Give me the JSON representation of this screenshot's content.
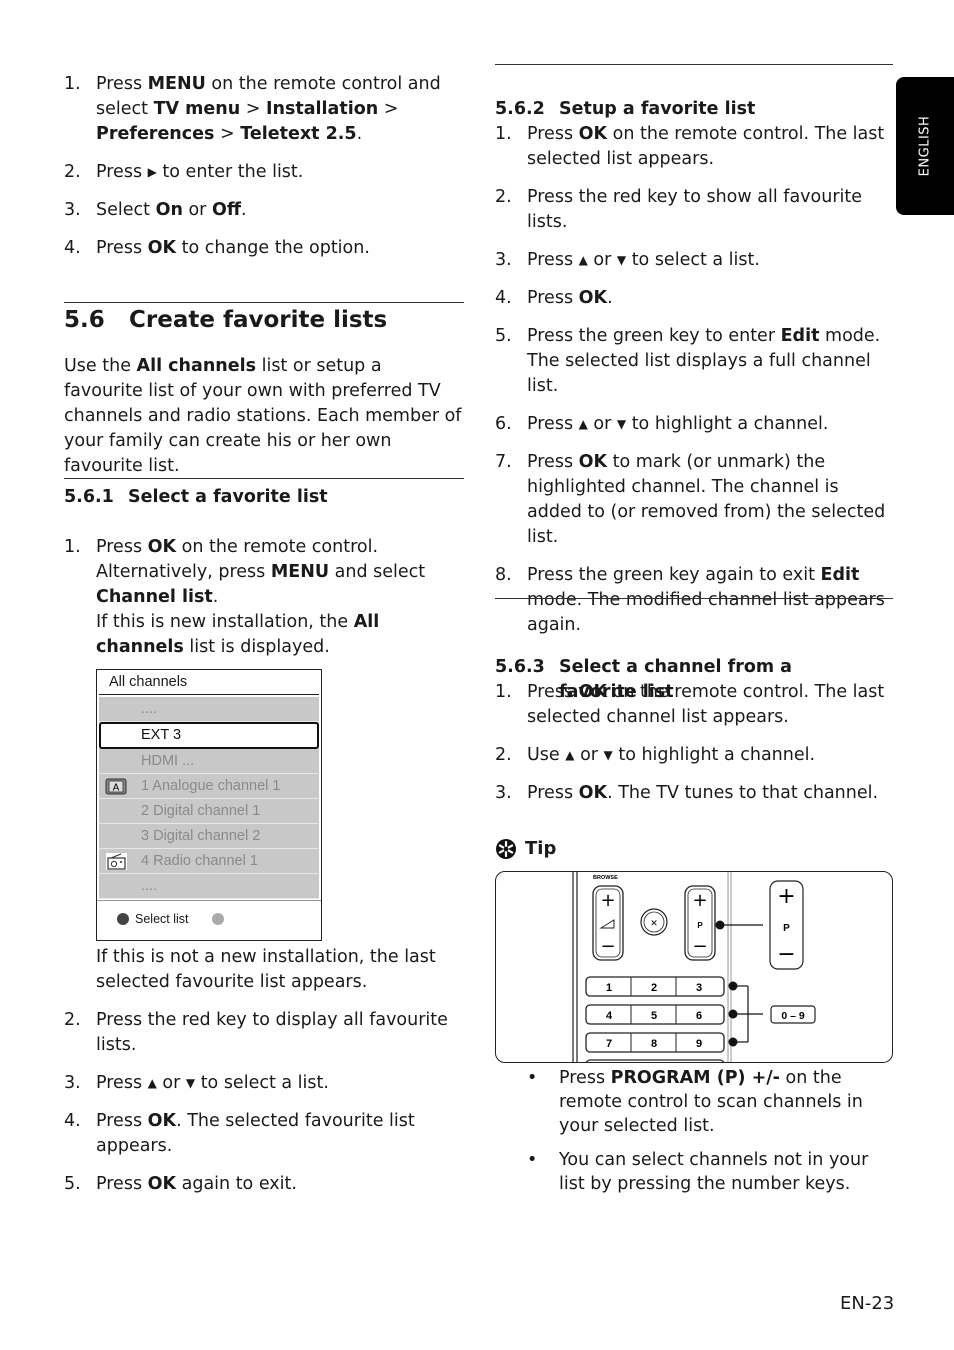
{
  "side_tab": {
    "label": "ENGLISH"
  },
  "left": {
    "intro_steps": [
      {
        "num": "1.",
        "html": "Press <b>MENU</b> on the remote control and select <b>TV menu</b> &gt; <b>Installation</b> &gt; <b>Preferences</b> &gt; <b>Teletext 2.5</b>."
      },
      {
        "num": "2.",
        "html": "Press <span class=\"tri\">▶</span> to enter the list."
      },
      {
        "num": "3.",
        "html": "Select <b>On</b> or <b>Off</b>."
      },
      {
        "num": "4.",
        "html": "Press <b>OK</b> to change the option."
      }
    ],
    "section": {
      "number": "5.6",
      "title": "Create favorite lists"
    },
    "section_intro": "Use the <b>All channels</b> list or setup a favourite list of your own with preferred TV channels and radio stations. Each member of your family can create his or her own favourite list.",
    "sub1": {
      "number": "5.6.1",
      "title": "Select a favorite list"
    },
    "sub1_step1": "Press <b>OK</b> on the remote control. Alternatively, press <b>MENU</b> and select <b>Channel list</b>.<br>If this is new installation, the <b>All channels</b> list is displayed.",
    "sub1_after_menu": "If this is not a new installation, the last selected favourite list appears.",
    "sub1_steps": [
      {
        "num": "2.",
        "html": "Press the red key to display all favourite lists."
      },
      {
        "num": "3.",
        "html": "Press <span class=\"tri\">▲</span> or <span class=\"tri\">▼</span> to select a list."
      },
      {
        "num": "4.",
        "html": "Press <b>OK</b>. The selected favourite list appears."
      },
      {
        "num": "5.",
        "html": "Press <b>OK</b> again to exit."
      }
    ]
  },
  "channel_menu": {
    "title": "All channels",
    "rows": [
      {
        "label": "....",
        "icon": "",
        "selected": false
      },
      {
        "label": "EXT 3",
        "icon": "",
        "selected": true
      },
      {
        "label": "HDMI ...",
        "icon": "",
        "selected": false
      },
      {
        "label": "1 Analogue channel 1",
        "icon": "analogue-tv-icon",
        "selected": false
      },
      {
        "label": "2 Digital channel 1",
        "icon": "",
        "selected": false
      },
      {
        "label": "3 Digital channel 2",
        "icon": "",
        "selected": false
      },
      {
        "label": "4 Radio channel 1",
        "icon": "radio-icon",
        "selected": false
      },
      {
        "label": "....",
        "icon": "",
        "selected": false
      }
    ],
    "footer_label": "Select list"
  },
  "right": {
    "sub2": {
      "number": "5.6.2",
      "title": "Setup a favorite list"
    },
    "sub2_steps": [
      {
        "num": "1.",
        "html": "Press <b>OK</b> on the remote control. The last selected list appears."
      },
      {
        "num": "2.",
        "html": "Press the red key to show all favourite lists."
      },
      {
        "num": "3.",
        "html": "Press <span class=\"tri\">▲</span> or <span class=\"tri\">▼</span> to select a list."
      },
      {
        "num": "4.",
        "html": "Press <b>OK</b>."
      },
      {
        "num": "5.",
        "html": "Press the green key to enter <b>Edit</b> mode. The selected list displays a full channel list."
      },
      {
        "num": "6.",
        "html": "Press <span class=\"tri\">▲</span> or <span class=\"tri\">▼</span> to highlight a channel."
      },
      {
        "num": "7.",
        "html": "Press <b>OK</b> to mark (or unmark) the highlighted channel. The channel is added to (or removed from) the selected list."
      },
      {
        "num": "8.",
        "html": "Press the green key again to exit <b>Edit</b> mode. The modified channel list appears again."
      }
    ],
    "sub3": {
      "number": "5.6.3",
      "title": "Select a channel from a favorite list"
    },
    "sub3_steps": [
      {
        "num": "1.",
        "html": "Press <b>OK</b> on the remote control. The last selected channel list appears."
      },
      {
        "num": "2.",
        "html": "Use <span class=\"tri\">▲</span> or <span class=\"tri\">▼</span> to highlight a channel."
      },
      {
        "num": "3.",
        "html": "Press <b>OK</b>. The TV tunes to that channel."
      }
    ],
    "tip_label": "Tip",
    "remote": {
      "browse_label": "BROWSE",
      "plus": "+",
      "minus": "−",
      "p_label": "P",
      "keys": [
        "1",
        "2",
        "3",
        "4",
        "5",
        "6",
        "7",
        "8",
        "9"
      ],
      "range_label": "0 – 9"
    },
    "tip_bullets": [
      {
        "bullet": "•",
        "html": "Press <b>PROGRAM (P) +/-</b> on the remote control to scan channels in your selected list."
      },
      {
        "bullet": "•",
        "html": "You can select channels not in your list by pressing the number keys."
      }
    ]
  },
  "page_number": "EN-23"
}
